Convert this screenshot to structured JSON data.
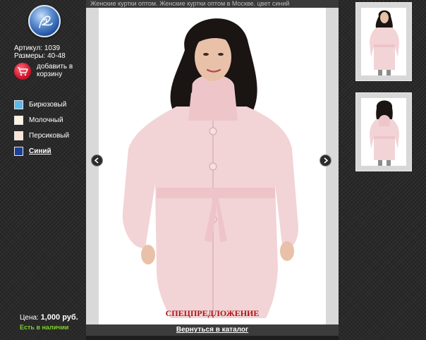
{
  "page": {
    "title": "Женские куртки оптом. Женские куртки оптом в Москве. цвет синий"
  },
  "product": {
    "article": "Артикул: 1039",
    "sizes": "Размеры: 40-48",
    "add_to_cart": "добавить в корзину",
    "price_label": "Цена:",
    "price_value": "1,000 руб.",
    "stock": "Есть в наличии"
  },
  "colors": [
    {
      "name": "Бирюзовый",
      "swatch": "#5ab8ea",
      "selected": false
    },
    {
      "name": "Молочный",
      "swatch": "#fdf1e2",
      "selected": false
    },
    {
      "name": "Персиковый",
      "swatch": "#fbe3d6",
      "selected": false
    },
    {
      "name": "Синий",
      "swatch": "#1b3f95",
      "selected": true
    }
  ],
  "viewer": {
    "promo_text": "СПЕЦПРЕДЛОЖЕНИЕ",
    "back_link": "Вернуться в каталог"
  },
  "icons": {
    "logo": "logo-icon",
    "cart": "cart-icon",
    "prev": "chevron-left-icon",
    "next": "chevron-right-icon"
  },
  "colors_theme": {
    "background": "#2a2a2a",
    "stock_green": "#7fd12b",
    "promo_red": "#a81717"
  }
}
